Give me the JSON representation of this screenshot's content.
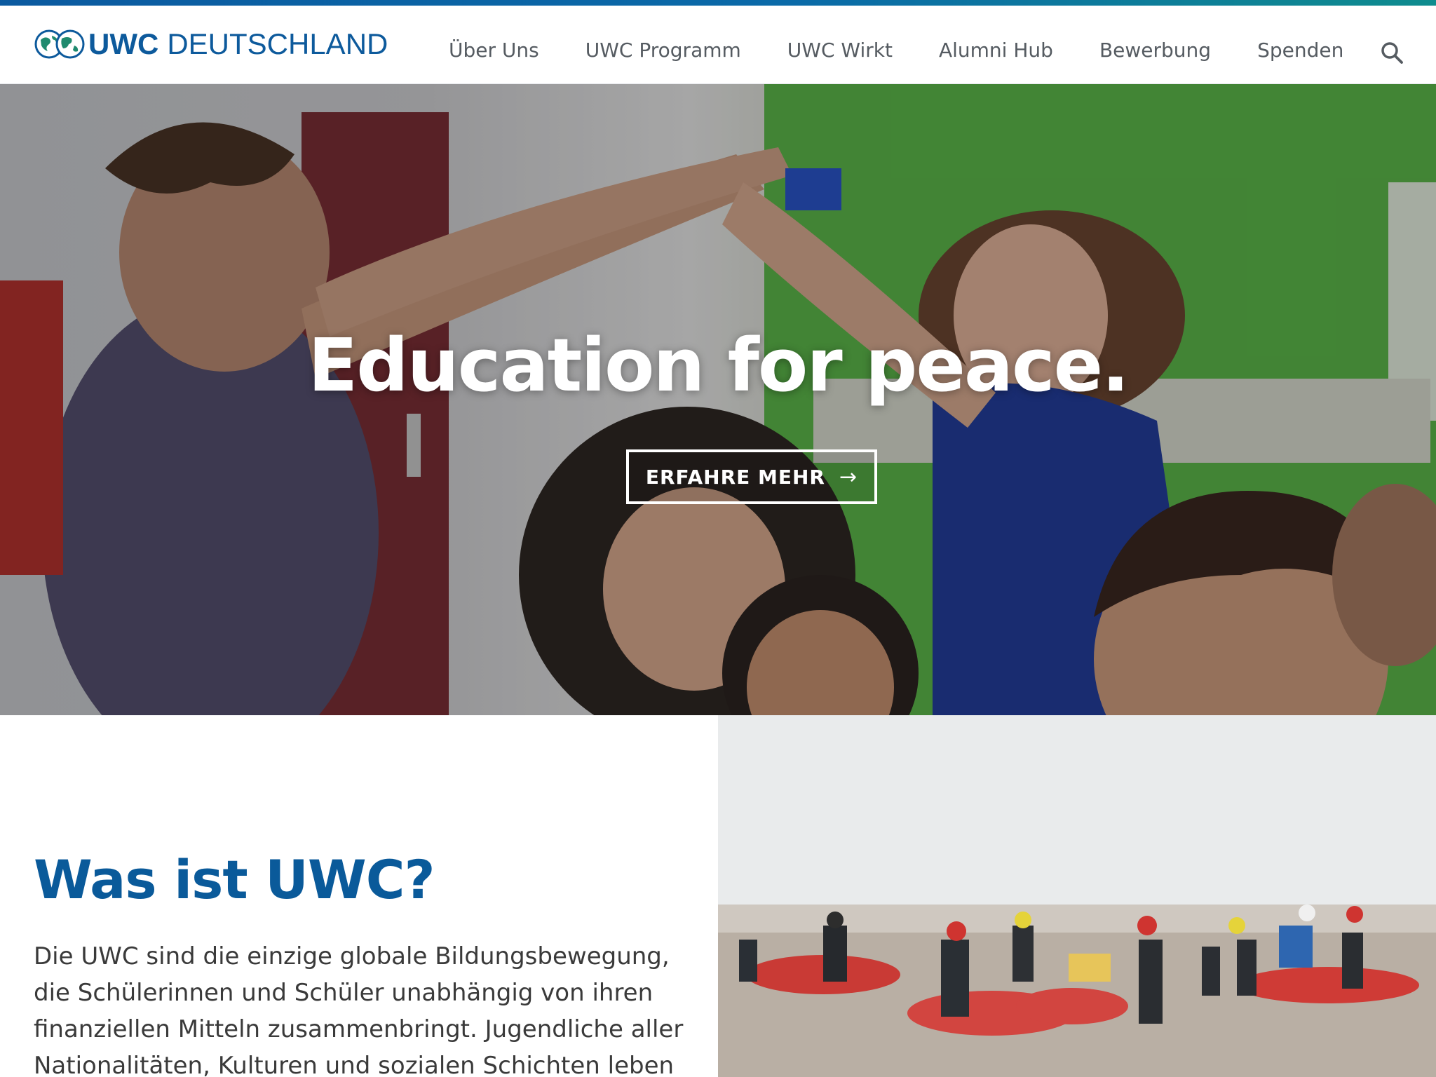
{
  "brand": {
    "uwc": "UWC",
    "country": "DEUTSCHLAND",
    "color": "#0d5a9c"
  },
  "nav": {
    "items": [
      {
        "label": "Über Uns"
      },
      {
        "label": "UWC Programm"
      },
      {
        "label": "UWC Wirkt"
      },
      {
        "label": "Alumni Hub"
      },
      {
        "label": "Bewerbung"
      },
      {
        "label": "Spenden"
      }
    ],
    "search_icon": "search-icon"
  },
  "hero": {
    "title": "Education for peace.",
    "cta_label": "ERFAHRE MEHR",
    "cta_arrow": "→"
  },
  "about": {
    "title": "Was ist UWC?",
    "text": "Die UWC sind die einzige globale Bildungsbewegung, die Schülerinnen und Schüler unabhängig von ihren finanziellen Mitteln zusammenbringt. Jugendliche aller Nationalitäten, Kulturen und sozialen Schichten leben und"
  },
  "colors": {
    "accent_blue": "#0b5aa0",
    "accent_teal": "#0f8c8e",
    "heading_blue": "#0a5a9a",
    "nav_text": "#555b61",
    "body_text": "#3a3a3a"
  }
}
